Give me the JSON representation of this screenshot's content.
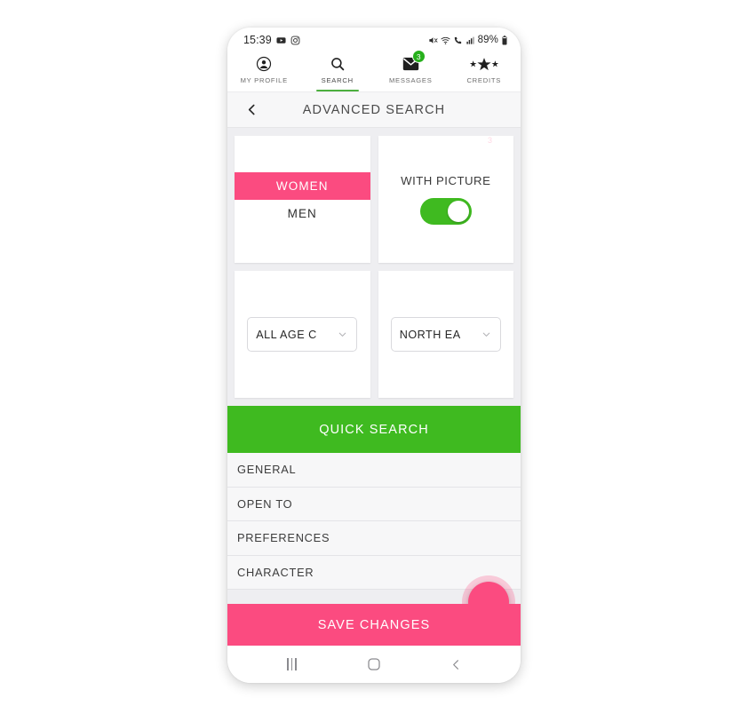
{
  "status_bar": {
    "time": "15:39",
    "left_icons": [
      "youtube-icon",
      "instagram-icon"
    ],
    "right_icons": [
      "mute-icon",
      "wifi-icon",
      "call-signal-icon",
      "cellular-signal-icon"
    ],
    "battery": "89%"
  },
  "top_nav": {
    "tabs": [
      {
        "label": "MY PROFILE",
        "icon": "account-circle-icon",
        "active": false,
        "badge": null
      },
      {
        "label": "SEARCH",
        "icon": "search-icon",
        "active": true,
        "badge": null
      },
      {
        "label": "MESSAGES",
        "icon": "envelope-icon",
        "active": false,
        "badge": "3"
      },
      {
        "label": "CREDITS",
        "icon": "stars-icon",
        "active": false,
        "badge": null
      }
    ]
  },
  "header": {
    "back_icon": "chevron-left-icon",
    "title": "ADVANCED SEARCH"
  },
  "filters": {
    "gender": {
      "options": [
        {
          "label": "WOMEN",
          "selected": true
        },
        {
          "label": "MEN",
          "selected": false
        }
      ]
    },
    "with_picture": {
      "label": "WITH PICTURE",
      "enabled": true
    },
    "age_category": {
      "value": "ALL AGE C",
      "caret_icon": "chevron-down-icon"
    },
    "region": {
      "value": "NORTH EA",
      "caret_icon": "chevron-down-icon"
    }
  },
  "quick_search": {
    "label": "QUICK SEARCH"
  },
  "sections": [
    {
      "label": "GENERAL"
    },
    {
      "label": "OPEN TO"
    },
    {
      "label": "PREFERENCES"
    },
    {
      "label": "CHARACTER"
    }
  ],
  "fab": {
    "badge": "3"
  },
  "save_bar": {
    "label": "SAVE CHANGES"
  },
  "nav_bar": {
    "recents": "recents-icon",
    "home": "home-icon",
    "back": "back-icon"
  },
  "colors": {
    "pink": "#FB4B80",
    "green": "#3FBA20",
    "badge_green": "#27B01C",
    "page_bg": "#EEEEF1",
    "list_bg": "#F7F7F8"
  }
}
